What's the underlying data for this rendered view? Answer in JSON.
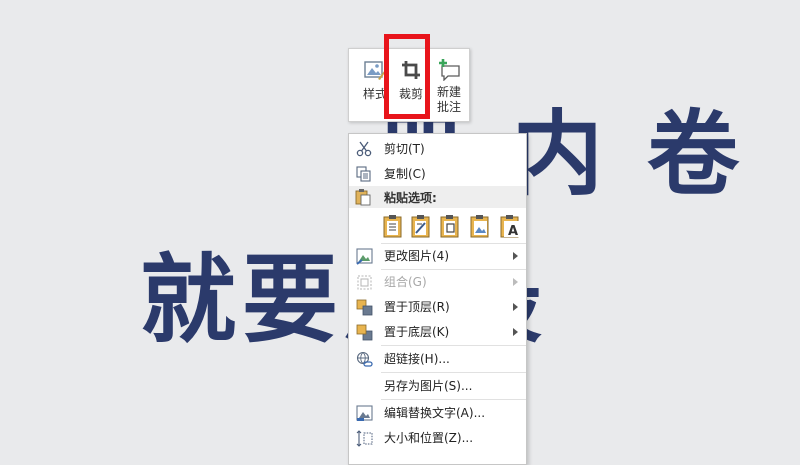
{
  "background": {
    "line1": "册 内 卷",
    "line2": "就要成最"
  },
  "mini_toolbar": {
    "style_label": "样式",
    "crop_label": "裁剪",
    "comment_label_1": "新建",
    "comment_label_2": "批注"
  },
  "context_menu": {
    "cut": "剪切(T)",
    "copy": "复制(C)",
    "paste_options": "粘贴选项:",
    "change_picture": "更改图片(4)",
    "group": "组合(G)",
    "bring_to_front": "置于顶层(R)",
    "send_to_back": "置于底层(K)",
    "hyperlink": "超链接(H)...",
    "save_as_picture": "另存为图片(S)...",
    "edit_alt_text": "编辑替换文字(A)...",
    "size_position": "大小和位置(Z)..."
  },
  "colors": {
    "highlight": "#e8141b",
    "background_text": "#2b3a6b"
  }
}
